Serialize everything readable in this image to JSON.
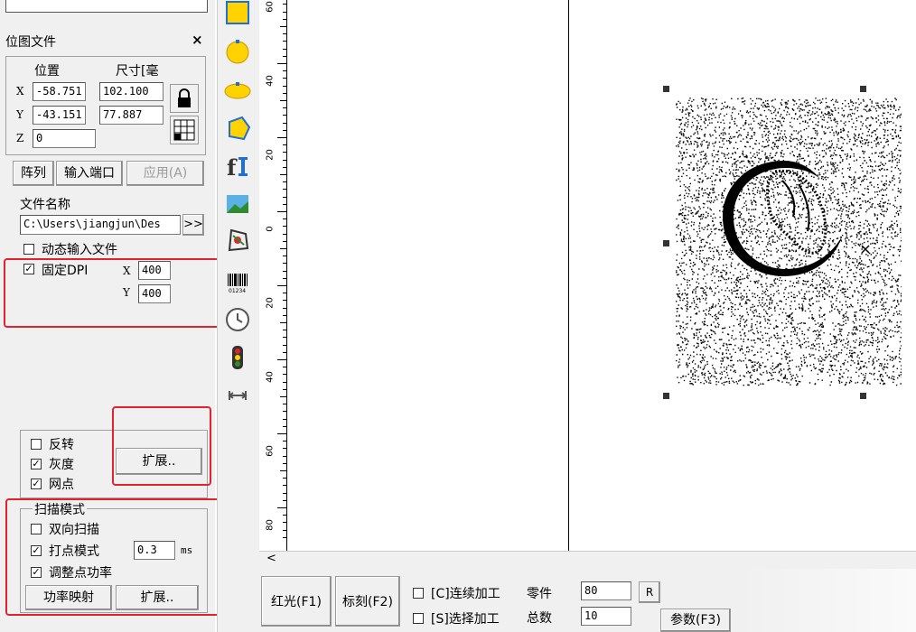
{
  "panel": {
    "title": "位图文件",
    "close_icon": "×",
    "pos_header": "位置",
    "size_header": "尺寸[毫",
    "x_label": "X",
    "y_label": "Y",
    "z_label": "Z",
    "x_pos": "-58.751",
    "x_size": "102.100",
    "y_pos": "-43.151",
    "y_size": "77.887",
    "z_pos": "0",
    "array_btn": "阵列",
    "input_port_btn": "输入端口",
    "apply_btn": "应用(A)",
    "file_name_label": "文件名称",
    "file_path": "C:\\Users\\jiangjun\\Des",
    "browse_btn": ">>",
    "dynamic_input": "动态输入文件",
    "fixed_dpi": "固定DPI",
    "dpi_x_label": "X",
    "dpi_x": "400",
    "dpi_y_label": "Y",
    "dpi_y": "400",
    "invert": "反转",
    "grayscale": "灰度",
    "dither": "网点",
    "extend_btn": "扩展..",
    "scan_mode_title": "扫描模式",
    "bidirectional": "双向扫描",
    "dot_mode": "打点模式",
    "dot_time": "0.3",
    "dot_unit": "ms",
    "adjust_power": "调整点功率",
    "power_map_btn": "功率映射",
    "extend_btn2": "扩展.."
  },
  "ruler": {
    "labels": [
      "60",
      "40",
      "20",
      "0",
      "20",
      "40",
      "60",
      "80"
    ]
  },
  "bottom": {
    "red_light_btn": "红光(F1)",
    "mark_btn": "标刻(F2)",
    "continuous": "[C]连续加工",
    "selected": "[S]选择加工",
    "parts_label": "零件",
    "parts_value": "80",
    "r_btn": "R",
    "total_label": "总数",
    "total_value": "10",
    "params_btn": "参数(F3)",
    "scroll_left": "<"
  },
  "colors": {
    "red_highlight": "#e0232c",
    "panel_bg": "#f0f0f0"
  }
}
